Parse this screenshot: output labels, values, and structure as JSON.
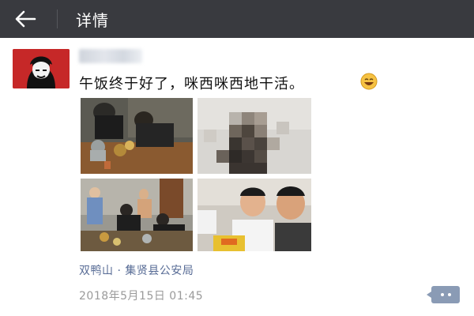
{
  "header": {
    "title": "详情",
    "back_icon": "arrow-left-icon",
    "background": "#393a3f"
  },
  "post": {
    "text": "午饭终于好了，咪西咪西地干活。",
    "emoji_icon": "grinning-emoji-icon",
    "location": "双鸭山 · 集贤县公安局",
    "timestamp": "2018年5月15日 01:45",
    "comment_icon": "comment-dots-icon"
  },
  "colors": {
    "link": "#576b95",
    "timestamp": "#9a9a9a",
    "comment_button": "#8a9bb5"
  }
}
